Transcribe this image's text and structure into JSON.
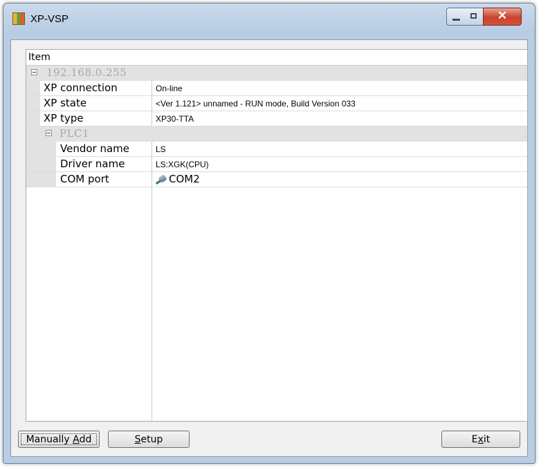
{
  "window": {
    "title": "XP-VSP",
    "controls": {
      "minimize": "minimize",
      "maximize": "maximize",
      "close": "✕"
    }
  },
  "grid": {
    "header": "Item",
    "device": {
      "label": "192.168.0.255",
      "properties": [
        {
          "name": "XP connection",
          "value": "On-line"
        },
        {
          "name": "XP state",
          "value": "<Ver 1.121> unnamed - RUN mode, Build Version 033"
        },
        {
          "name": "XP type",
          "value": "XP30-TTA"
        }
      ],
      "plc": {
        "label": "PLC1",
        "properties": [
          {
            "name": "Vendor name",
            "value": "LS"
          },
          {
            "name": "Driver name",
            "value": "LS:XGK(CPU)"
          },
          {
            "name": "COM port",
            "value": "COM2",
            "icon": "plug-icon"
          }
        ]
      }
    }
  },
  "buttons": {
    "manually_add": {
      "before": "Manually ",
      "mnemonic": "A",
      "after": "dd"
    },
    "setup": {
      "before": "",
      "mnemonic": "S",
      "after": "etup"
    },
    "exit": {
      "before": "E",
      "mnemonic": "x",
      "after": "it"
    }
  }
}
